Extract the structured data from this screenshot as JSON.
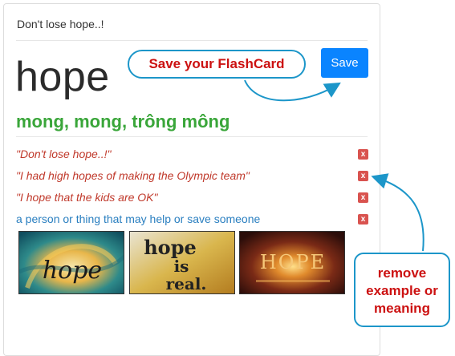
{
  "card": {
    "header": "Don't lose hope..!",
    "word": "hope",
    "translation": "mong, mong, trông mông",
    "save_label": "Save"
  },
  "entries": [
    {
      "type": "example",
      "text": "\"Don't lose hope..!\"",
      "remove_label": "x"
    },
    {
      "type": "example",
      "text": "\"I had high hopes of making the Olympic team\"",
      "remove_label": "x"
    },
    {
      "type": "example",
      "text": "\"I hope that the kids are OK\"",
      "remove_label": "x"
    },
    {
      "type": "meaning",
      "text": "a person or thing that may help or save someone",
      "remove_label": "x"
    }
  ],
  "images": [
    {
      "name": "hope-swirl-image",
      "caption": "hope"
    },
    {
      "name": "hope-is-real-image",
      "caption_line1": "hope",
      "caption_line2": "is",
      "caption_line3": "real."
    },
    {
      "name": "hope-sunrise-image",
      "caption": "HOPE"
    }
  ],
  "callouts": {
    "save": "Save your FlashCard",
    "remove_line1": "remove",
    "remove_line2": "example or",
    "remove_line3": "meaning"
  },
  "colors": {
    "save_button": "#0a84ff",
    "translation": "#3aa63a",
    "example_text": "#c0392b",
    "meaning_text": "#2a7fc0",
    "remove_button": "#d9534f",
    "callout_border": "#1c96c9",
    "callout_text": "#cc1111"
  }
}
